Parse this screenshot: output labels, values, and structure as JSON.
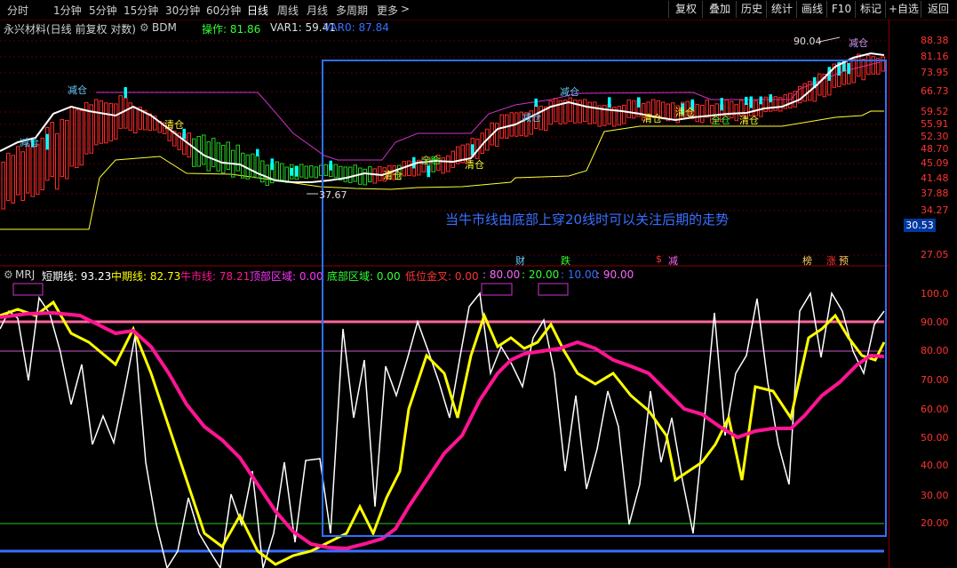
{
  "toolbar": {
    "periods": [
      "分时",
      "1分钟",
      "5分钟",
      "15分钟",
      "30分钟",
      "60分钟",
      "日线",
      "周线",
      "月线",
      "多周期",
      "更多"
    ],
    "active": "日线",
    "more_arrow": ">",
    "buttons": [
      "复权",
      "叠加",
      "历史",
      "统计",
      "画线",
      "F10",
      "标记",
      "+自选",
      "返回"
    ]
  },
  "main_header": {
    "stock": "永兴材料(日线 前复权 对数)",
    "indicator": "BDM",
    "op_label": "操作: 81.86",
    "var1_label": "VAR1: 59.41",
    "var0_label": "VAR0: 87.84"
  },
  "price_axis": [
    "88.38",
    "81.16",
    "73.95",
    "66.73",
    "59.52",
    "55.91",
    "52.30",
    "48.70",
    "45.09",
    "41.48",
    "37.88",
    "34.27",
    "27.05"
  ],
  "current_price": "30.53",
  "high_marker": "90.04",
  "low_marker": "37.67",
  "signals": {
    "jiancang": "减仓",
    "qingcang": "清仓",
    "quancang": "全仓"
  },
  "annotation_text": "当牛市线由底部上穿20线时可以关注后期的走势",
  "event_tags": [
    "财",
    "跌",
    "$",
    "减",
    "榜",
    "涨",
    "预"
  ],
  "sub_header": {
    "name": "MRJ",
    "short": "短期线: 93.23",
    "mid": "中期线: 82.73",
    "bull": "牛市线: 78.21",
    "top": "顶部区域: 0.00",
    "bottom": "底部区域: 0.00",
    "cross": "低位金叉: 0.00",
    "l80": ": 80.00",
    "l20": ": 20.00",
    "l10": ": 10.00",
    "l90": ": 90.00"
  },
  "sub_axis": [
    "100.0",
    "90.00",
    "80.00",
    "70.00",
    "60.00",
    "50.00",
    "40.00",
    "30.00",
    "20.00"
  ],
  "colors": {
    "up": "#ff2a2a",
    "down": "#00ffff",
    "bull_line": "#ff1493",
    "mid_line": "#ffff00",
    "short_line": "#ffffff",
    "box": "#2f6fff"
  },
  "chart_data": [
    {
      "type": "line",
      "title": "",
      "series": [
        {
          "name": "牛市线",
          "values": [
            92,
            93,
            92,
            92,
            91,
            90,
            88,
            85,
            80,
            70,
            58,
            45,
            32,
            22,
            17,
            16,
            17,
            20,
            30,
            45,
            58,
            70,
            77,
            79,
            80,
            81,
            83,
            82,
            80,
            76,
            72,
            66,
            60,
            55,
            52,
            51,
            52,
            54,
            58,
            64,
            70,
            76,
            79,
            78
          ]
        },
        {
          "name": "中期线",
          "values": [
            92,
            95,
            96,
            93,
            88,
            84,
            78,
            70,
            55,
            38,
            25,
            19,
            17,
            16,
            18,
            22,
            30,
            52,
            70,
            82,
            84,
            83,
            82,
            80,
            78,
            74,
            70,
            66,
            60,
            52,
            44,
            38,
            42,
            58,
            70,
            72,
            80,
            88,
            92,
            86,
            80,
            78,
            80,
            82
          ]
        }
      ]
    }
  ]
}
